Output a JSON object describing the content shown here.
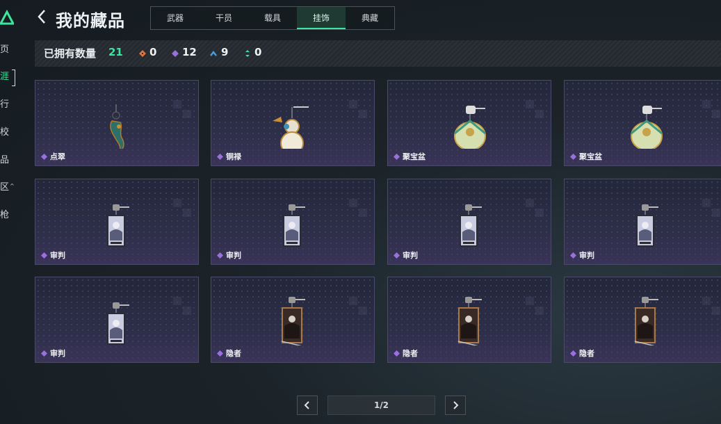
{
  "nav": {
    "items": [
      {
        "label": "页"
      },
      {
        "label": "涯"
      },
      {
        "label": "行"
      },
      {
        "label": "校"
      },
      {
        "label": "品"
      },
      {
        "label": "区"
      },
      {
        "label": "枪"
      }
    ],
    "active_index": 1
  },
  "header": {
    "title": "我的藏品",
    "tabs": [
      "武器",
      "干员",
      "载具",
      "挂饰",
      "典藏"
    ],
    "active_tab": "挂饰"
  },
  "stats": {
    "label": "已拥有数量",
    "total": "21",
    "counts": [
      {
        "icon": "orange-diamond-icon",
        "value": "0",
        "color": "#e0733a"
      },
      {
        "icon": "purple-diamond-icon",
        "value": "12",
        "color": "#9a6fe0"
      },
      {
        "icon": "blue-chevron-icon",
        "value": "9",
        "color": "#4a9de0"
      },
      {
        "icon": "green-arrows-icon",
        "value": "0",
        "color": "#3de6a0"
      }
    ]
  },
  "items": [
    {
      "name": "点翠",
      "art": "jade-phoenix-charm-icon"
    },
    {
      "name": "铜禄",
      "art": "gourd-charm-icon"
    },
    {
      "name": "聚宝盆",
      "art": "treasure-bowl-charm-icon"
    },
    {
      "name": "聚宝盆",
      "art": "treasure-bowl-charm-icon"
    },
    {
      "name": "审判",
      "art": "judgment-card-charm-icon"
    },
    {
      "name": "审判",
      "art": "judgment-card-charm-icon"
    },
    {
      "name": "审判",
      "art": "judgment-card-charm-icon"
    },
    {
      "name": "审判",
      "art": "judgment-card-charm-icon"
    },
    {
      "name": "审判",
      "art": "judgment-card-charm-icon"
    },
    {
      "name": "隐者",
      "art": "hermit-card-charm-icon"
    },
    {
      "name": "隐者",
      "art": "hermit-card-charm-icon"
    },
    {
      "name": "隐者",
      "art": "hermit-card-charm-icon"
    }
  ],
  "pagination": {
    "label": "1/2"
  },
  "colors": {
    "accent": "#3de6a0",
    "rarity": "#9a6fe0"
  }
}
